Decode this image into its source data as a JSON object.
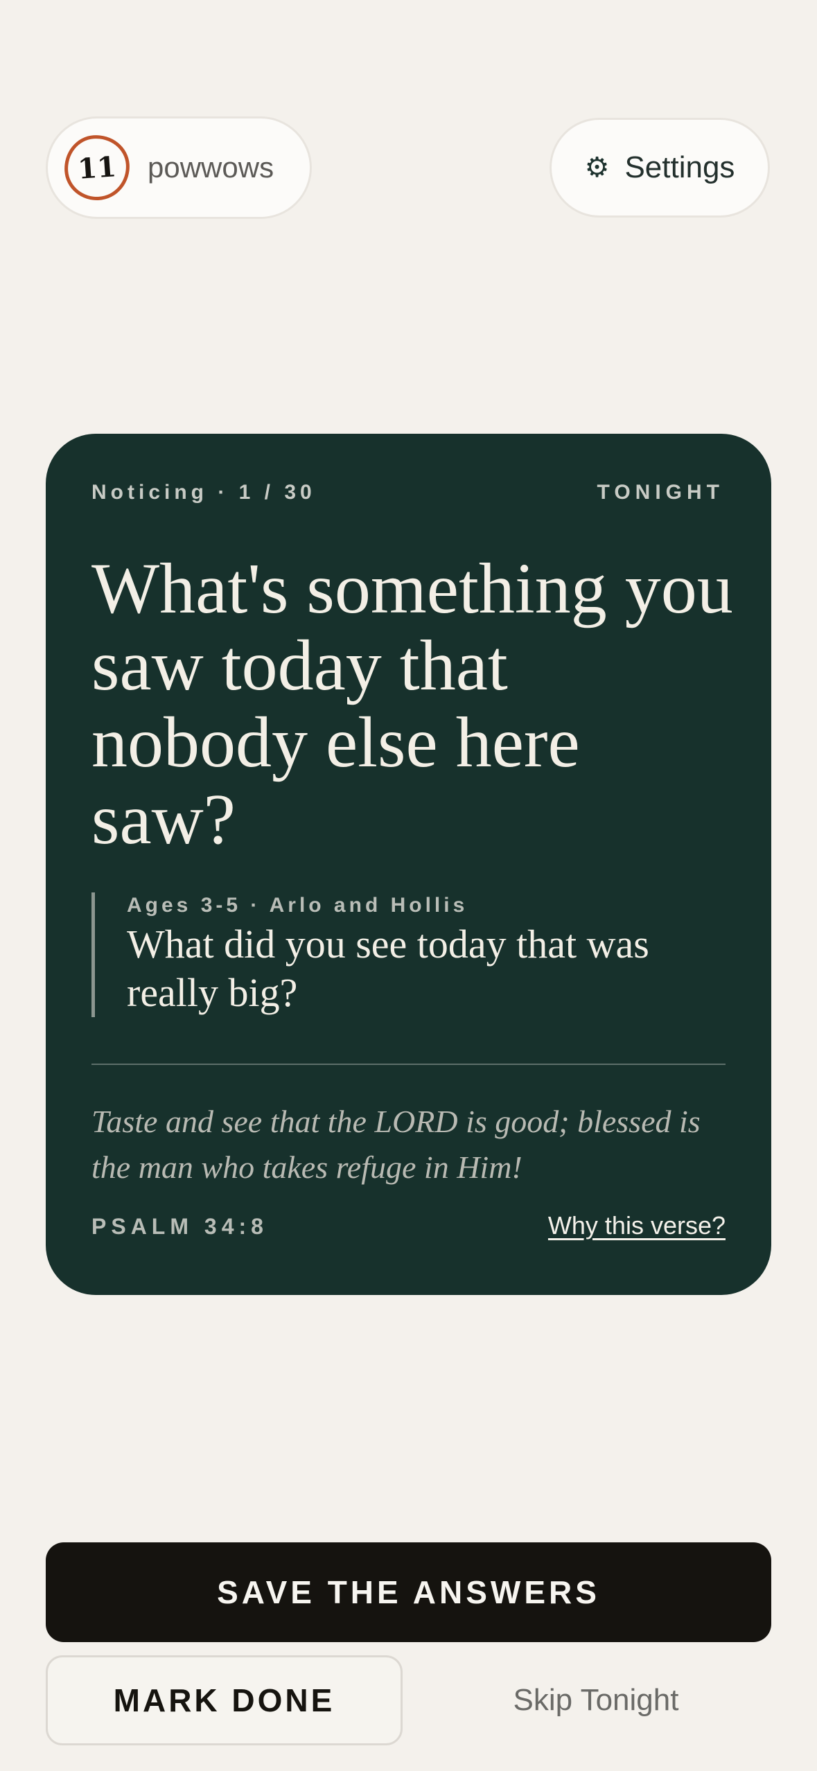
{
  "header": {
    "streak_count": "11",
    "streak_label": "powwows",
    "settings_icon": "gear-icon",
    "settings_label": "Settings"
  },
  "card": {
    "meta": "Noticing · 1 / 30",
    "tag": "TONIGHT",
    "question": "What's something you saw today that nobody else here saw?",
    "kids_meta": "Ages 3-5 · Arlo and Hollis",
    "kids_question": "What did you see today that was really big?",
    "verse": "Taste and see that the LORD is good; blessed is the man who takes refuge in Him!",
    "verse_ref": "PSALM 34:8",
    "why_link": "Why this verse?"
  },
  "actions": {
    "save_label": "SAVE THE ANSWERS",
    "done_label": "MARK DONE",
    "skip_label": "Skip Tonight"
  },
  "colors": {
    "background": "#f4f1ec",
    "card": "#17312c",
    "accent": "#c0542a",
    "primary_button": "#15130f"
  }
}
